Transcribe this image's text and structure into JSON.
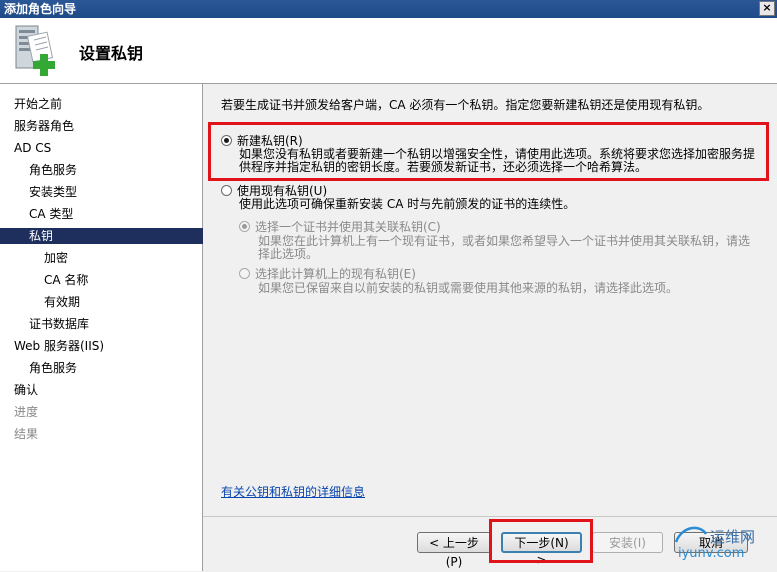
{
  "window": {
    "title": "添加角色向导",
    "close_label": "×"
  },
  "header": {
    "title": "设置私钥"
  },
  "sidebar": {
    "items": [
      {
        "label": "开始之前"
      },
      {
        "label": "服务器角色"
      },
      {
        "label": "AD CS"
      },
      {
        "label": "角色服务"
      },
      {
        "label": "安装类型"
      },
      {
        "label": "CA 类型"
      },
      {
        "label": "私钥"
      },
      {
        "label": "加密"
      },
      {
        "label": "CA 名称"
      },
      {
        "label": "有效期"
      },
      {
        "label": "证书数据库"
      },
      {
        "label": "Web 服务器(IIS)"
      },
      {
        "label": "角色服务"
      },
      {
        "label": "确认"
      },
      {
        "label": "进度"
      },
      {
        "label": "结果"
      }
    ]
  },
  "main": {
    "intro": "若要生成证书并颁发给客户端，CA 必须有一个私钥。指定您要新建私钥还是使用现有私钥。",
    "option_new": {
      "label": "新建私钥(R)",
      "desc": "如果您没有私钥或者要新建一个私钥以增强安全性，请使用此选项。系统将要求您选择加密服务提供程序并指定私钥的密钥长度。若要颁发新证书，还必须选择一个哈希算法。",
      "selected": true
    },
    "option_existing": {
      "label": "使用现有私钥(U)",
      "desc": "使用此选项可确保重新安装 CA 时与先前颁发的证书的连续性。",
      "selected": false
    },
    "sub_cert": {
      "label": "选择一个证书并使用其关联私钥(C)",
      "desc": "如果您在此计算机上有一个现有证书，或者如果您希望导入一个证书并使用其关联私钥，请选择此选项。"
    },
    "sub_key": {
      "label": "选择此计算机上的现有私钥(E)",
      "desc": "如果您已保留来自以前安装的私钥或需要使用其他来源的私钥，请选择此选项。"
    },
    "more_info_link": "有关公钥和私钥的详细信息"
  },
  "footer": {
    "prev_label": "< 上一步(P)",
    "next_label": "下一步(N) >",
    "install_label": "安装(I)",
    "cancel_label": "取消"
  },
  "watermark": {
    "top": "运维网",
    "bottom": "iyunv.com"
  },
  "colors": {
    "titlebar": "#2b5797",
    "active_nav": "#1e2f5e",
    "highlight": "#e0121a",
    "link": "#0645ad"
  }
}
